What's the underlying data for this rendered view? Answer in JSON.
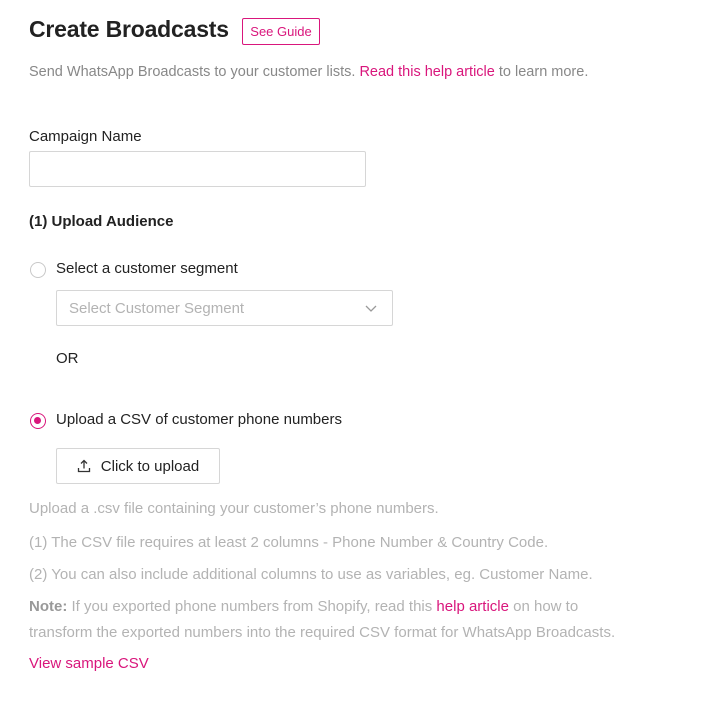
{
  "header": {
    "title": "Create Broadcasts",
    "guide_button": "See Guide"
  },
  "subtitle": {
    "prefix": "Send WhatsApp Broadcasts to your customer lists.",
    "link": "Read this help article",
    "suffix": "to learn more."
  },
  "campaign": {
    "label": "Campaign Name",
    "value": "",
    "placeholder": ""
  },
  "audience": {
    "heading": "(1) Upload Audience",
    "segment_option": {
      "label": "Select a customer segment",
      "checked": false,
      "dropdown_placeholder": "Select Customer Segment"
    },
    "or_text": "OR",
    "csv_option": {
      "label": "Upload a CSV of customer phone numbers",
      "checked": true,
      "upload_button": "Click to upload"
    }
  },
  "help": {
    "line1": "Upload a .csv file containing your customer’s phone numbers.",
    "line2": "(1) The CSV file requires at least 2 columns - Phone Number & Country Code.",
    "line3": "(2) You can also include additional columns to use as variables, eg. Customer Name.",
    "note_label": "Note:",
    "note_prefix": " If you exported phone numbers from Shopify, read this ",
    "note_link": "help article",
    "note_suffix": " on how to",
    "note_line2": "transform the exported numbers into the required CSV format for WhatsApp Broadcasts.",
    "sample_link": "View sample CSV"
  },
  "colors": {
    "accent": "#d9167c",
    "muted_text": "#b3b3b3",
    "border": "#d6d6d6"
  },
  "icons": {
    "upload": "upload-icon",
    "dropdown": "chevron-down-icon"
  }
}
